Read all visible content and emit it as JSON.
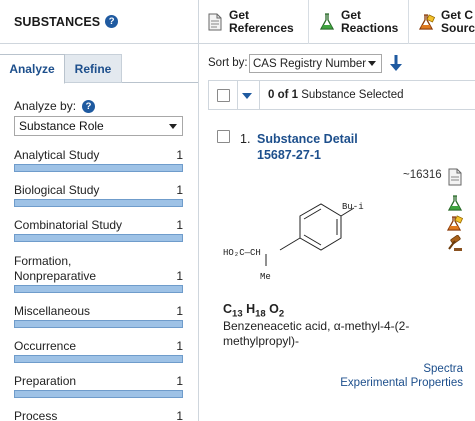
{
  "left": {
    "title": "SUBSTANCES",
    "tabs": [
      {
        "label": "Analyze",
        "active": true
      },
      {
        "label": "Refine",
        "active": false
      }
    ],
    "analyze_by_label": "Analyze by:",
    "analyze_by_value": "Substance Role",
    "facets": [
      {
        "label": "Analytical Study",
        "count": "1"
      },
      {
        "label": "Biological Study",
        "count": "1"
      },
      {
        "label": "Combinatorial Study",
        "count": "1"
      },
      {
        "label_line1": "Formation,",
        "label_line2": "Nonpreparative",
        "count": "1"
      },
      {
        "label": "Miscellaneous",
        "count": "1"
      },
      {
        "label_line1": "Occurrence",
        "count": "1"
      },
      {
        "label": "Preparation",
        "count": "1"
      },
      {
        "label": "Process",
        "count": "1"
      }
    ]
  },
  "toolbar": {
    "get_references_line1": "Get",
    "get_references_line2": "References",
    "get_reactions_line1": "Get",
    "get_reactions_line2": "Reactions",
    "get_source_line1": "Get C",
    "get_source_line2": "Sourc"
  },
  "sort": {
    "label": "Sort by:",
    "value": "CAS Registry Number"
  },
  "selection": {
    "count_bold": "0 of 1",
    "text": " Substance Selected"
  },
  "result": {
    "index": "1.",
    "title_line1": "Substance Detail",
    "title_line2": "15687-27-1",
    "reference_count": "~16316",
    "structure_labels": {
      "substituent": "Bu-i",
      "acid": "HO₂C—CH",
      "methyl": "Me"
    },
    "formula_parts": [
      "C",
      "13",
      " H",
      "18",
      " O",
      "2"
    ],
    "name": "Benzeneacetic acid, α-methyl-4-(2-methylpropyl)-",
    "links": [
      "Spectra",
      "Experimental Properties"
    ]
  },
  "colors": {
    "link": "#1d4f8c",
    "bar_fill": "#9ec2e6",
    "bar_border": "#6f9ccb",
    "help_icon": "#1f5aa0"
  }
}
